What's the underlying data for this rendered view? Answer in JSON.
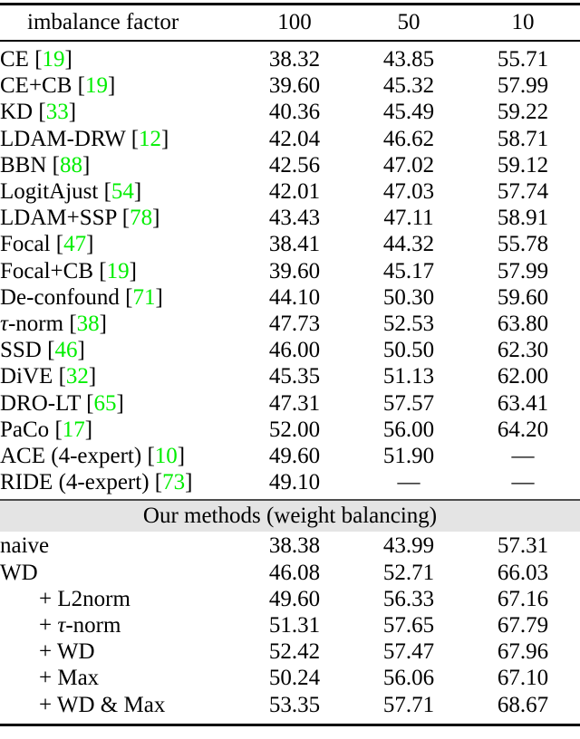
{
  "table": {
    "header": {
      "method_label": "imbalance factor",
      "columns": [
        "100",
        "50",
        "10"
      ]
    },
    "section_band_label": "Our methods (weight balancing)",
    "dash": "—",
    "colors": {
      "reference_green": "#00ee00",
      "band_background": "#e4e4e4",
      "text": "#000000",
      "rule": "#000000"
    },
    "rows_prior": [
      {
        "method": "CE",
        "ref": "19",
        "v1": "38.32",
        "v2": "43.85",
        "v3": "55.71"
      },
      {
        "method": "CE+CB",
        "ref": "19",
        "v1": "39.60",
        "v2": "45.32",
        "v3": "57.99"
      },
      {
        "method": "KD",
        "ref": "33",
        "v1": "40.36",
        "v2": "45.49",
        "v3": "59.22"
      },
      {
        "method": "LDAM-DRW",
        "ref": "12",
        "v1": "42.04",
        "v2": "46.62",
        "v3": "58.71"
      },
      {
        "method": "BBN",
        "ref": "88",
        "v1": "42.56",
        "v2": "47.02",
        "v3": "59.12"
      },
      {
        "method": "LogitAjust",
        "ref": "54",
        "v1": "42.01",
        "v2": "47.03",
        "v3": "57.74"
      },
      {
        "method": "LDAM+SSP",
        "ref": "78",
        "v1": "43.43",
        "v2": "47.11",
        "v3": "58.91"
      },
      {
        "method": "Focal",
        "ref": "47",
        "v1": "38.41",
        "v2": "44.32",
        "v3": "55.78"
      },
      {
        "method": "Focal+CB",
        "ref": "19",
        "v1": "39.60",
        "v2": "45.17",
        "v3": "57.99"
      },
      {
        "method": "De-confound",
        "ref": "71",
        "v1": "44.10",
        "v2": "50.30",
        "v3": "59.60"
      },
      {
        "method": "τ-norm",
        "ref": "38",
        "v1": "47.73",
        "v2": "52.53",
        "v3": "63.80",
        "tau": true
      },
      {
        "method": "SSD",
        "ref": "46",
        "v1": "46.00",
        "v2": "50.50",
        "v3": "62.30"
      },
      {
        "method": "DiVE",
        "ref": "32",
        "v1": "45.35",
        "v2": "51.13",
        "v3": "62.00"
      },
      {
        "method": "DRO-LT",
        "ref": "65",
        "v1": "47.31",
        "v2": "57.57",
        "v3": "63.41"
      },
      {
        "method": "PaCo",
        "ref": "17",
        "v1": "52.00",
        "v2": "56.00",
        "v3": "64.20"
      },
      {
        "method": "ACE (4-expert)",
        "ref": "10",
        "v1": "49.60",
        "v2": "51.90",
        "v3": "—"
      },
      {
        "method": "RIDE (4-expert)",
        "ref": "73",
        "v1": "49.10",
        "v2": "—",
        "v3": "—"
      }
    ],
    "rows_ours": [
      {
        "method": "naive",
        "v1": "38.38",
        "v2": "43.99",
        "v3": "57.31",
        "indent": false,
        "bold": false
      },
      {
        "method": "WD",
        "v1": "46.08",
        "v2": "52.71",
        "v3": "66.03",
        "indent": false,
        "bold": false
      },
      {
        "method": "+ L2norm",
        "v1": "49.60",
        "v2": "56.33",
        "v3": "67.16",
        "indent": true,
        "bold": false
      },
      {
        "method": "+ τ-norm",
        "v1": "51.31",
        "v2": "57.65",
        "v3": "67.79",
        "indent": true,
        "bold": false,
        "tau": true
      },
      {
        "method": "+ WD",
        "v1": "52.42",
        "v2": "57.47",
        "v3": "67.96",
        "indent": true,
        "bold": false
      },
      {
        "method": "+ Max",
        "v1": "50.24",
        "v2": "56.06",
        "v3": "67.10",
        "indent": true,
        "bold": false
      },
      {
        "method": "+ WD & Max",
        "v1": "53.35",
        "v2": "57.71",
        "v3": "68.67",
        "indent": true,
        "bold": true
      }
    ]
  }
}
